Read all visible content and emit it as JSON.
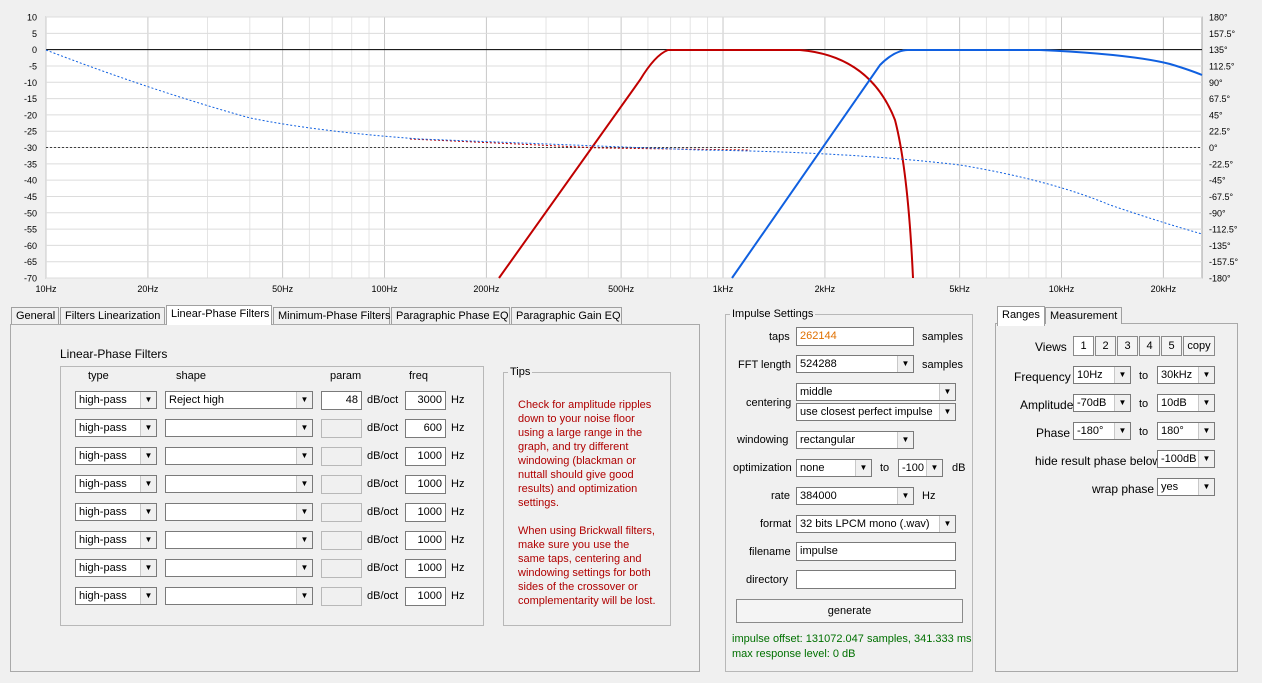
{
  "graph": {
    "left_axis": [
      "10",
      "5",
      "0",
      "-5",
      "-10",
      "-15",
      "-20",
      "-25",
      "-30",
      "-35",
      "-40",
      "-45",
      "-50",
      "-55",
      "-60",
      "-65",
      "-70"
    ],
    "right_axis": [
      "180°",
      "157.5°",
      "135°",
      "112.5°",
      "90°",
      "67.5°",
      "45°",
      "22.5°",
      "0°",
      "-22.5°",
      "-45°",
      "-67.5°",
      "-90°",
      "-112.5°",
      "-135°",
      "-157.5°",
      "-180°"
    ],
    "x_labels": [
      "10Hz",
      "20Hz",
      "50Hz",
      "100Hz",
      "200Hz",
      "500Hz",
      "1kHz",
      "2kHz",
      "5kHz",
      "10kHz",
      "20kHz"
    ],
    "colors": {
      "red": "#c00000",
      "blue": "#1060e0",
      "grid": "#d8d8d8",
      "bg": "#ffffff"
    }
  },
  "tabs": [
    "General",
    "Filters Linearization",
    "Linear-Phase Filters",
    "Minimum-Phase Filters",
    "Paragraphic Phase EQ",
    "Paragraphic Gain EQ"
  ],
  "lpf": {
    "title": "Linear-Phase Filters",
    "headers": {
      "type": "type",
      "shape": "shape",
      "param": "param",
      "freq": "freq"
    },
    "unit_db": "dB/oct",
    "unit_hz": "Hz",
    "rows": [
      {
        "type": "high-pass",
        "shape": "Reject high",
        "param": "48",
        "freq": "3000"
      },
      {
        "type": "high-pass",
        "shape": "",
        "param": "",
        "freq": "600"
      },
      {
        "type": "high-pass",
        "shape": "",
        "param": "",
        "freq": "1000"
      },
      {
        "type": "high-pass",
        "shape": "",
        "param": "",
        "freq": "1000"
      },
      {
        "type": "high-pass",
        "shape": "",
        "param": "",
        "freq": "1000"
      },
      {
        "type": "high-pass",
        "shape": "",
        "param": "",
        "freq": "1000"
      },
      {
        "type": "high-pass",
        "shape": "",
        "param": "",
        "freq": "1000"
      },
      {
        "type": "high-pass",
        "shape": "",
        "param": "",
        "freq": "1000"
      }
    ]
  },
  "tips": {
    "title": "Tips",
    "p1": [
      "Check for amplitude ripples",
      "down to your noise floor",
      "using a large range in the",
      "graph, and try different",
      "windowing (blackman or",
      "nuttall should give good",
      "results) and optimization",
      "settings."
    ],
    "p2": [
      "When using Brickwall filters,",
      "make sure you use the",
      "same taps, centering and",
      "windowing settings for both",
      "sides of the crossover or",
      "complementarity will be lost."
    ]
  },
  "impulse": {
    "title": "Impulse Settings",
    "taps_label": "taps",
    "taps_value": "262144",
    "samples": "samples",
    "fft_label": "FFT length",
    "fft_value": "524288",
    "centering_label": "centering",
    "centering_value": "middle",
    "centering_value2": "use closest perfect impulse",
    "windowing_label": "windowing",
    "windowing_value": "rectangular",
    "optimization_label": "optimization",
    "optimization_value": "none",
    "to": "to",
    "opt_db_value": "-100",
    "db": "dB",
    "rate_label": "rate",
    "rate_value": "384000",
    "hz": "Hz",
    "format_label": "format",
    "format_value": "32 bits LPCM mono (.wav)",
    "filename_label": "filename",
    "filename_value": "impulse",
    "directory_label": "directory",
    "directory_value": "",
    "generate": "generate",
    "offset_text": "impulse offset: 131072.047 samples, 341.333 ms",
    "max_text": "max response level: 0 dB"
  },
  "ranges": {
    "tabs": [
      "Ranges",
      "Measurement"
    ],
    "views_label": "Views",
    "views": [
      "1",
      "2",
      "3",
      "4",
      "5"
    ],
    "copy": "copy",
    "frequency_label": "Frequency",
    "freq_from": "10Hz",
    "freq_to": "30kHz",
    "amplitude_label": "Amplitude",
    "amp_from": "-70dB",
    "amp_to": "10dB",
    "phase_label": "Phase",
    "phase_from": "-180°",
    "phase_to": "180°",
    "to": "to",
    "hide_label": "hide result phase below",
    "hide_value": "-100dB",
    "wrap_label": "wrap phase",
    "wrap_value": "yes"
  }
}
